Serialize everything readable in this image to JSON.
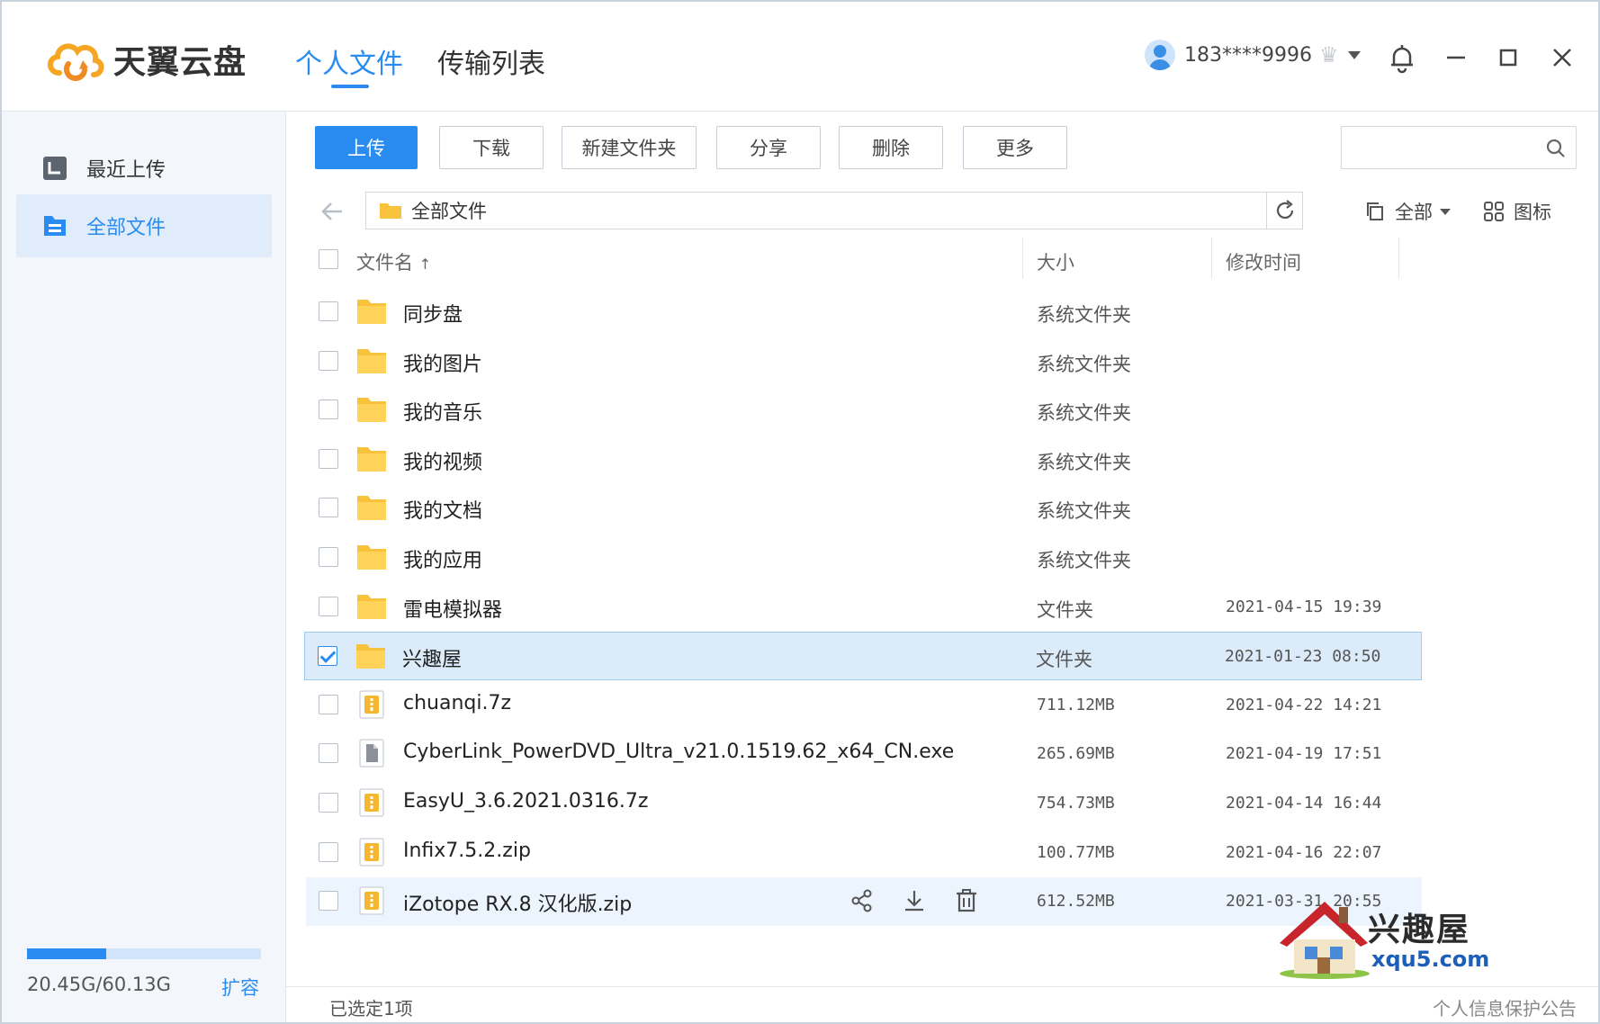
{
  "app": {
    "name": "天翼云盘",
    "brand_color": "#2a8cf0",
    "logo_colors": [
      "#f5a623",
      "#f08a24"
    ]
  },
  "nav": {
    "tabs": [
      {
        "label": "个人文件",
        "active": true
      },
      {
        "label": "传输列表",
        "active": false
      }
    ]
  },
  "user": {
    "phone": "183****9996",
    "icons": [
      "avatar",
      "crown-icon",
      "chevron-down-icon"
    ]
  },
  "window_controls": [
    "bell-icon",
    "minimize-icon",
    "maximize-icon",
    "close-icon"
  ],
  "sidebar": {
    "items": [
      {
        "label": "最近上传",
        "icon": "recent-upload-icon",
        "active": false
      },
      {
        "label": "全部文件",
        "icon": "all-files-icon",
        "active": true
      }
    ],
    "storage": {
      "text": "20.45G/60.13G",
      "used_fraction": 0.34,
      "expand_label": "扩容"
    }
  },
  "toolbar": {
    "upload": "上传",
    "download": "下载",
    "new_folder": "新建文件夹",
    "share": "分享",
    "delete": "删除",
    "more": "更多",
    "search_placeholder": ""
  },
  "pathbar": {
    "path": "全部文件",
    "filter_label": "全部",
    "view_label": "图标"
  },
  "table": {
    "headers": {
      "name": "文件名",
      "sort_indicator": "↑",
      "size": "大小",
      "modified": "修改时间"
    },
    "rows": [
      {
        "name": "同步盘",
        "type": "folder",
        "size": "系统文件夹",
        "modified": "",
        "checked": false
      },
      {
        "name": "我的图片",
        "type": "folder",
        "size": "系统文件夹",
        "modified": "",
        "checked": false
      },
      {
        "name": "我的音乐",
        "type": "folder",
        "size": "系统文件夹",
        "modified": "",
        "checked": false
      },
      {
        "name": "我的视频",
        "type": "folder",
        "size": "系统文件夹",
        "modified": "",
        "checked": false
      },
      {
        "name": "我的文档",
        "type": "folder",
        "size": "系统文件夹",
        "modified": "",
        "checked": false
      },
      {
        "name": "我的应用",
        "type": "folder",
        "size": "系统文件夹",
        "modified": "",
        "checked": false
      },
      {
        "name": "雷电模拟器",
        "type": "folder",
        "size": "文件夹",
        "modified": "2021-04-15 19:39",
        "checked": false
      },
      {
        "name": "兴趣屋",
        "type": "folder",
        "size": "文件夹",
        "modified": "2021-01-23 08:50",
        "checked": true
      },
      {
        "name": "chuanqi.7z",
        "type": "archive",
        "size": "711.12MB",
        "modified": "2021-04-22 14:21",
        "checked": false
      },
      {
        "name": "CyberLink_PowerDVD_Ultra_v21.0.1519.62_x64_CN.exe",
        "type": "file",
        "size": "265.69MB",
        "modified": "2021-04-19 17:51",
        "checked": false
      },
      {
        "name": "EasyU_3.6.2021.0316.7z",
        "type": "archive",
        "size": "754.73MB",
        "modified": "2021-04-14 16:44",
        "checked": false
      },
      {
        "name": "Infix7.5.2.zip",
        "type": "archive",
        "size": "100.77MB",
        "modified": "2021-04-16 22:07",
        "checked": false
      },
      {
        "name": "iZotope RX.8 汉化版.zip",
        "type": "archive",
        "size": "612.52MB",
        "modified": "2021-03-31 20:55",
        "checked": false,
        "hover": true
      }
    ],
    "row_action_icons": [
      "share-icon",
      "download-icon",
      "trash-icon"
    ]
  },
  "statusbar": {
    "selection": "已选定1项",
    "notice": "个人信息保护公告"
  },
  "watermark": {
    "title": "兴趣屋",
    "url": "xqu5.com"
  }
}
